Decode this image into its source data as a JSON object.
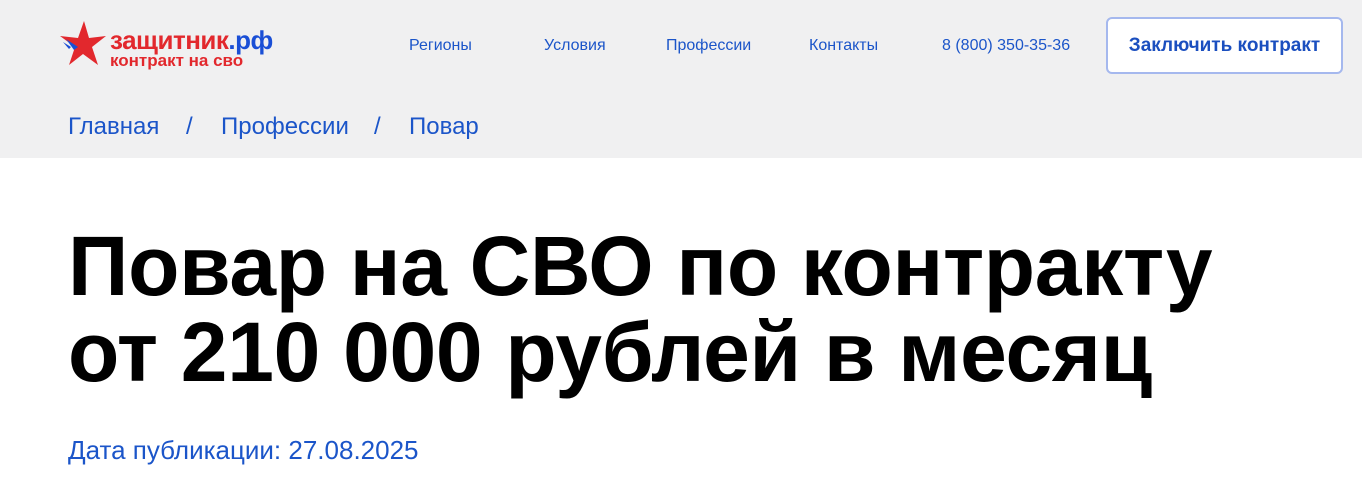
{
  "colors": {
    "accent_blue": "#1b55c9",
    "brand_red": "#e2282d",
    "topbar_bg": "#f0f0f1",
    "cta_border": "#a5b8ee"
  },
  "logo": {
    "icon": "red-star-icon",
    "name_part1": "защитник",
    "name_part2": ".рф",
    "tagline": "контракт на сво"
  },
  "nav": {
    "items": [
      {
        "label": "Регионы"
      },
      {
        "label": "Условия"
      },
      {
        "label": "Профессии"
      },
      {
        "label": "Контакты"
      }
    ],
    "phone": "8 (800) 350-35-36",
    "cta_label": "Заключить контракт"
  },
  "breadcrumb": {
    "items": [
      {
        "label": "Главная"
      },
      {
        "label": "Профессии"
      },
      {
        "label": "Повар"
      }
    ],
    "separator": "/"
  },
  "main": {
    "title_line1": "Повар на СВО по контракту",
    "title_line2": "от 210 000 рублей в месяц",
    "publication_date": "Дата публикации: 27.08.2025"
  }
}
